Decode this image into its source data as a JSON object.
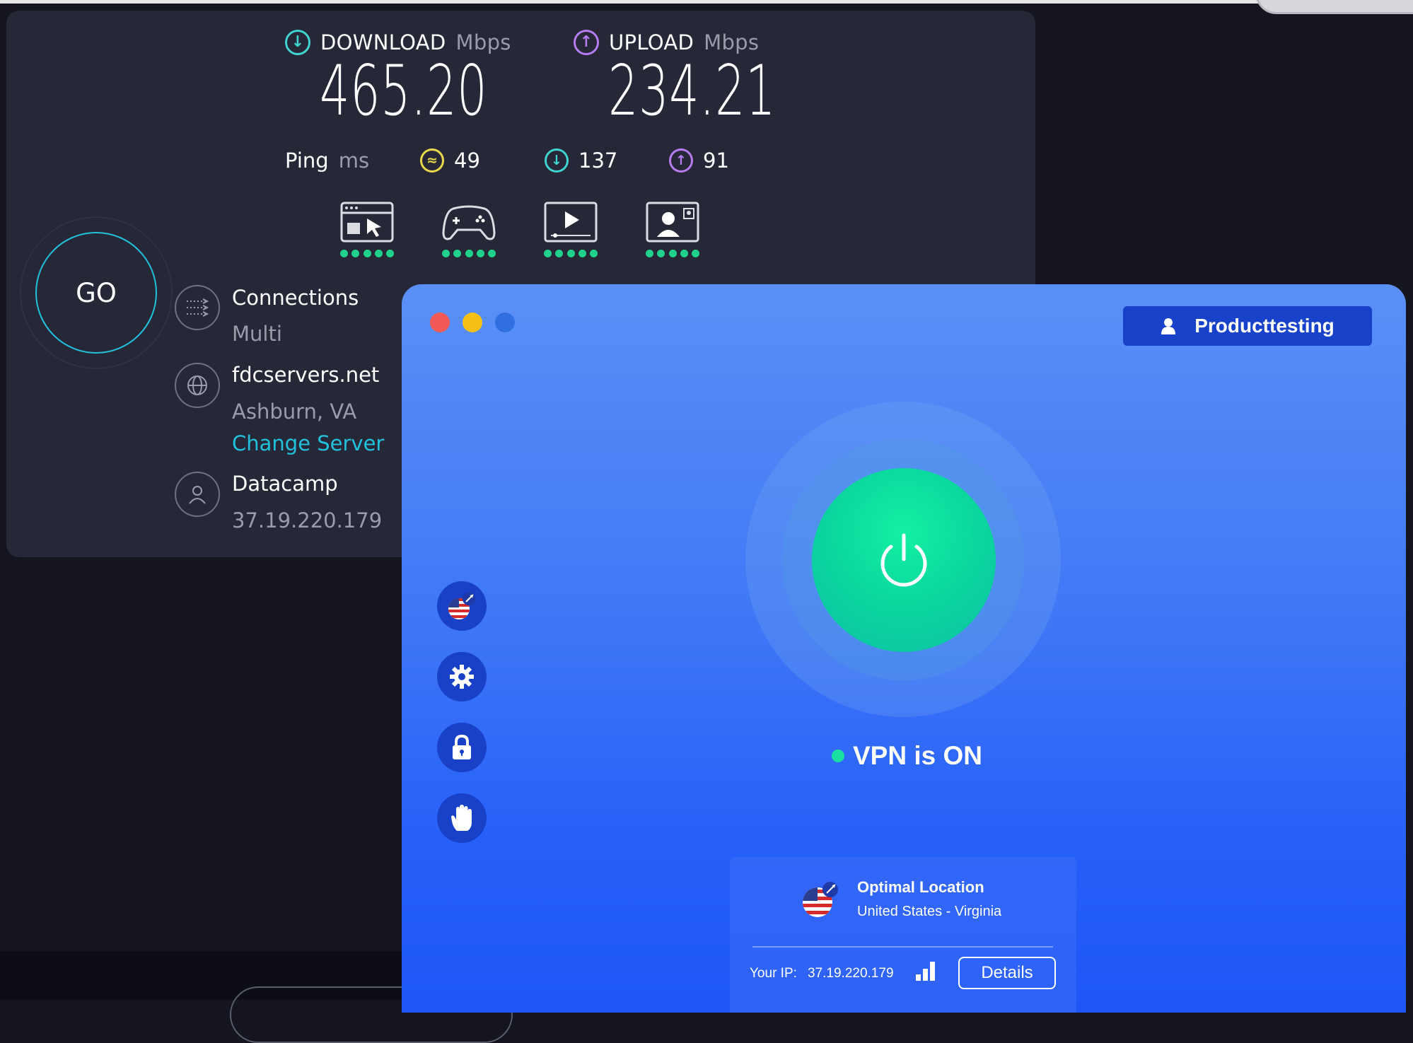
{
  "speedtest": {
    "download": {
      "label": "DOWNLOAD",
      "unit": "Mbps",
      "value": "465.20",
      "icon": "download-arrow-icon",
      "color": "#3fd4cf"
    },
    "upload": {
      "label": "UPLOAD",
      "unit": "Mbps",
      "value": "234.21",
      "icon": "upload-arrow-icon",
      "color": "#b67cf1"
    },
    "ping": {
      "label": "Ping",
      "unit": "ms",
      "idle": "49",
      "download": "137",
      "upload": "91",
      "idle_color": "#e8d84a"
    },
    "services": [
      {
        "name": "web-browsing-icon",
        "rating": 5
      },
      {
        "name": "gaming-icon",
        "rating": 5
      },
      {
        "name": "video-streaming-icon",
        "rating": 5
      },
      {
        "name": "video-call-icon",
        "rating": 5
      }
    ],
    "go_label": "GO",
    "connections": {
      "title": "Connections",
      "value": "Multi"
    },
    "server": {
      "title": "fdcservers.net",
      "location": "Ashburn, VA",
      "change_label": "Change Server"
    },
    "provider": {
      "title": "Datacamp",
      "ip": "37.19.220.179"
    },
    "accent": "#21c1de"
  },
  "vpn": {
    "user_label": "Producttesting",
    "status_text": "VPN is ON",
    "status_color": "#19e0a0",
    "location_title": "Optimal Location",
    "location_sub": "United States - Virginia",
    "ip_label": "Your IP:",
    "ip_value": "37.19.220.179",
    "details_label": "Details",
    "sidebar": [
      {
        "name": "locations-flag-icon"
      },
      {
        "name": "settings-gear-icon"
      },
      {
        "name": "security-lock-icon"
      },
      {
        "name": "blocker-hand-icon"
      }
    ]
  }
}
